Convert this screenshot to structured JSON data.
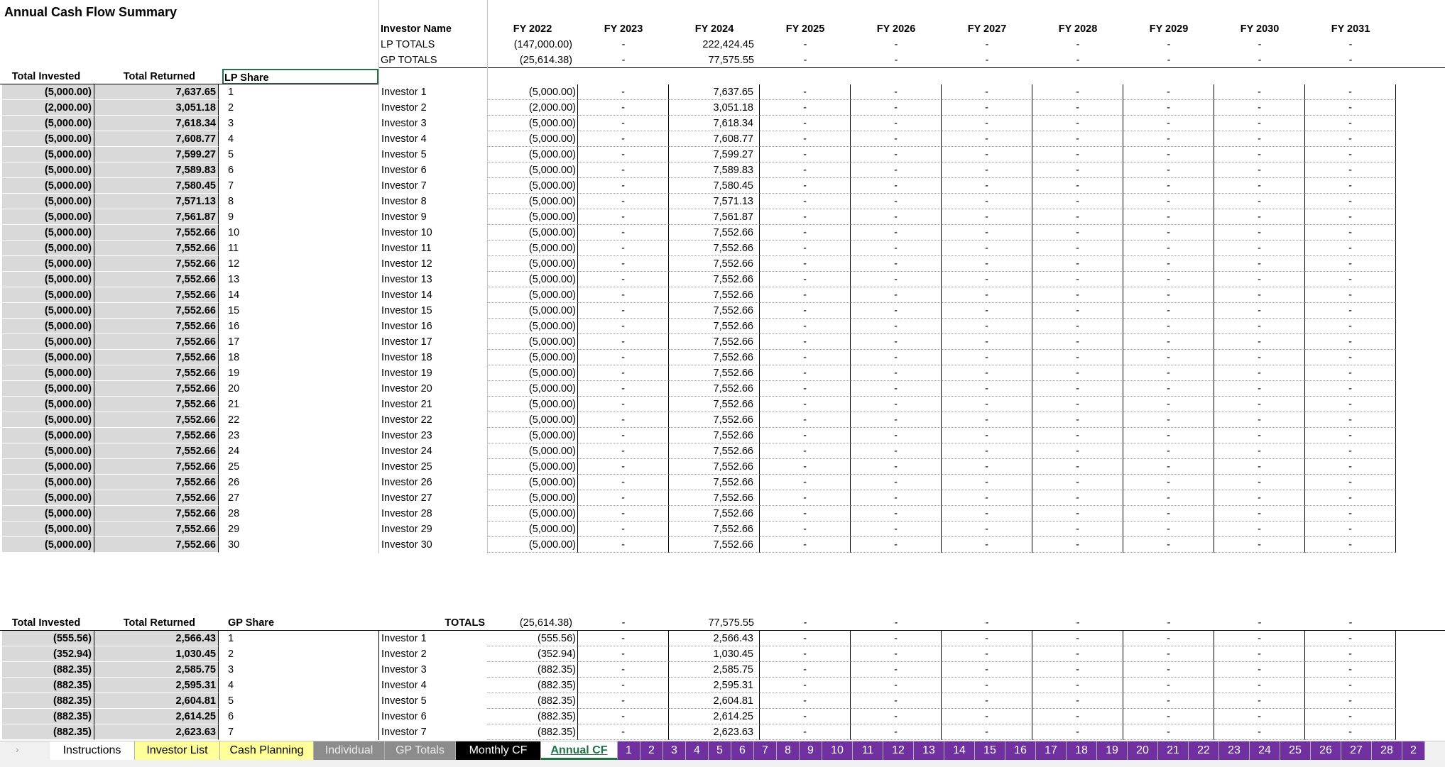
{
  "title": "Annual Cash Flow Summary",
  "lp": {
    "header_invested": "Total Invested",
    "header_returned": "Total Returned",
    "header_share": "LP Share",
    "header_name": "Investor Name",
    "totals_label": "LP TOTALS",
    "rows": [
      [
        "(5,000.00)",
        "7,637.65",
        "1",
        "Investor 1",
        "(5,000.00)",
        "7,637.65"
      ],
      [
        "(2,000.00)",
        "3,051.18",
        "2",
        "Investor 2",
        "(2,000.00)",
        "3,051.18"
      ],
      [
        "(5,000.00)",
        "7,618.34",
        "3",
        "Investor 3",
        "(5,000.00)",
        "7,618.34"
      ],
      [
        "(5,000.00)",
        "7,608.77",
        "4",
        "Investor 4",
        "(5,000.00)",
        "7,608.77"
      ],
      [
        "(5,000.00)",
        "7,599.27",
        "5",
        "Investor 5",
        "(5,000.00)",
        "7,599.27"
      ],
      [
        "(5,000.00)",
        "7,589.83",
        "6",
        "Investor 6",
        "(5,000.00)",
        "7,589.83"
      ],
      [
        "(5,000.00)",
        "7,580.45",
        "7",
        "Investor 7",
        "(5,000.00)",
        "7,580.45"
      ],
      [
        "(5,000.00)",
        "7,571.13",
        "8",
        "Investor 8",
        "(5,000.00)",
        "7,571.13"
      ],
      [
        "(5,000.00)",
        "7,561.87",
        "9",
        "Investor 9",
        "(5,000.00)",
        "7,561.87"
      ],
      [
        "(5,000.00)",
        "7,552.66",
        "10",
        "Investor 10",
        "(5,000.00)",
        "7,552.66"
      ],
      [
        "(5,000.00)",
        "7,552.66",
        "11",
        "Investor 11",
        "(5,000.00)",
        "7,552.66"
      ],
      [
        "(5,000.00)",
        "7,552.66",
        "12",
        "Investor 12",
        "(5,000.00)",
        "7,552.66"
      ],
      [
        "(5,000.00)",
        "7,552.66",
        "13",
        "Investor 13",
        "(5,000.00)",
        "7,552.66"
      ],
      [
        "(5,000.00)",
        "7,552.66",
        "14",
        "Investor 14",
        "(5,000.00)",
        "7,552.66"
      ],
      [
        "(5,000.00)",
        "7,552.66",
        "15",
        "Investor 15",
        "(5,000.00)",
        "7,552.66"
      ],
      [
        "(5,000.00)",
        "7,552.66",
        "16",
        "Investor 16",
        "(5,000.00)",
        "7,552.66"
      ],
      [
        "(5,000.00)",
        "7,552.66",
        "17",
        "Investor 17",
        "(5,000.00)",
        "7,552.66"
      ],
      [
        "(5,000.00)",
        "7,552.66",
        "18",
        "Investor 18",
        "(5,000.00)",
        "7,552.66"
      ],
      [
        "(5,000.00)",
        "7,552.66",
        "19",
        "Investor 19",
        "(5,000.00)",
        "7,552.66"
      ],
      [
        "(5,000.00)",
        "7,552.66",
        "20",
        "Investor 20",
        "(5,000.00)",
        "7,552.66"
      ],
      [
        "(5,000.00)",
        "7,552.66",
        "21",
        "Investor 21",
        "(5,000.00)",
        "7,552.66"
      ],
      [
        "(5,000.00)",
        "7,552.66",
        "22",
        "Investor 22",
        "(5,000.00)",
        "7,552.66"
      ],
      [
        "(5,000.00)",
        "7,552.66",
        "23",
        "Investor 23",
        "(5,000.00)",
        "7,552.66"
      ],
      [
        "(5,000.00)",
        "7,552.66",
        "24",
        "Investor 24",
        "(5,000.00)",
        "7,552.66"
      ],
      [
        "(5,000.00)",
        "7,552.66",
        "25",
        "Investor 25",
        "(5,000.00)",
        "7,552.66"
      ],
      [
        "(5,000.00)",
        "7,552.66",
        "26",
        "Investor 26",
        "(5,000.00)",
        "7,552.66"
      ],
      [
        "(5,000.00)",
        "7,552.66",
        "27",
        "Investor 27",
        "(5,000.00)",
        "7,552.66"
      ],
      [
        "(5,000.00)",
        "7,552.66",
        "28",
        "Investor 28",
        "(5,000.00)",
        "7,552.66"
      ],
      [
        "(5,000.00)",
        "7,552.66",
        "29",
        "Investor 29",
        "(5,000.00)",
        "7,552.66"
      ],
      [
        "(5,000.00)",
        "7,552.66",
        "30",
        "Investor 30",
        "(5,000.00)",
        "7,552.66"
      ]
    ]
  },
  "years": [
    "FY 2022",
    "FY 2023",
    "FY 2024",
    "FY 2025",
    "FY 2026",
    "FY 2027",
    "FY 2028",
    "FY 2029",
    "FY 2030",
    "FY 2031"
  ],
  "dash": "-",
  "lp_totals": [
    "(147,000.00)",
    "-",
    "222,424.45",
    "-",
    "-",
    "-",
    "-",
    "-",
    "-",
    "-"
  ],
  "gp_totals_label": "GP TOTALS",
  "gp_totals": [
    "(25,614.38)",
    "-",
    "77,575.55",
    "-",
    "-",
    "-",
    "-",
    "-",
    "-",
    "-"
  ],
  "gp": {
    "header_invested": "Total Invested",
    "header_returned": "Total Returned",
    "header_share": "GP Share",
    "totals_label": "TOTALS",
    "totals": [
      "(25,614.38)",
      "-",
      "77,575.55",
      "-",
      "-",
      "-",
      "-",
      "-",
      "-",
      "-"
    ],
    "rows": [
      [
        "(555.56)",
        "2,566.43",
        "1",
        "Investor 1",
        "(555.56)",
        "2,566.43"
      ],
      [
        "(352.94)",
        "1,030.45",
        "2",
        "Investor 2",
        "(352.94)",
        "1,030.45"
      ],
      [
        "(882.35)",
        "2,585.75",
        "3",
        "Investor 3",
        "(882.35)",
        "2,585.75"
      ],
      [
        "(882.35)",
        "2,595.31",
        "4",
        "Investor 4",
        "(882.35)",
        "2,595.31"
      ],
      [
        "(882.35)",
        "2,604.81",
        "5",
        "Investor 5",
        "(882.35)",
        "2,604.81"
      ],
      [
        "(882.35)",
        "2,614.25",
        "6",
        "Investor 6",
        "(882.35)",
        "2,614.25"
      ],
      [
        "(882.35)",
        "2,623.63",
        "7",
        "Investor 7",
        "(882.35)",
        "2,623.63"
      ]
    ]
  },
  "tabs": [
    {
      "label": "Instructions",
      "style": "plain"
    },
    {
      "label": "Investor List",
      "style": "yellow"
    },
    {
      "label": "Cash Planning",
      "style": "yellow"
    },
    {
      "label": "Individual",
      "style": "gray"
    },
    {
      "label": "GP Totals",
      "style": "gray"
    },
    {
      "label": "Monthly CF",
      "style": "black"
    },
    {
      "label": "Annual CF",
      "style": "active"
    },
    {
      "label": "1",
      "style": "purple"
    },
    {
      "label": "2",
      "style": "purple"
    },
    {
      "label": "3",
      "style": "purple"
    },
    {
      "label": "4",
      "style": "purple"
    },
    {
      "label": "5",
      "style": "purple"
    },
    {
      "label": "6",
      "style": "purple"
    },
    {
      "label": "7",
      "style": "purple"
    },
    {
      "label": "8",
      "style": "purple"
    },
    {
      "label": "9",
      "style": "purple"
    },
    {
      "label": "10",
      "style": "purple"
    },
    {
      "label": "11",
      "style": "purple"
    },
    {
      "label": "12",
      "style": "purple"
    },
    {
      "label": "13",
      "style": "purple"
    },
    {
      "label": "14",
      "style": "purple"
    },
    {
      "label": "15",
      "style": "purple"
    },
    {
      "label": "16",
      "style": "purple"
    },
    {
      "label": "17",
      "style": "purple"
    },
    {
      "label": "18",
      "style": "purple"
    },
    {
      "label": "19",
      "style": "purple"
    },
    {
      "label": "20",
      "style": "purple"
    },
    {
      "label": "21",
      "style": "purple"
    },
    {
      "label": "22",
      "style": "purple"
    },
    {
      "label": "23",
      "style": "purple"
    },
    {
      "label": "24",
      "style": "purple"
    },
    {
      "label": "25",
      "style": "purple"
    },
    {
      "label": "26",
      "style": "purple"
    },
    {
      "label": "27",
      "style": "purple"
    },
    {
      "label": "28",
      "style": "purple"
    },
    {
      "label": "2",
      "style": "purple"
    }
  ],
  "colors": {
    "accent": "#217346",
    "purple_tab": "#7030a0",
    "gray_cell": "#d9d9d9",
    "yellow_tab": "#ffff99"
  }
}
